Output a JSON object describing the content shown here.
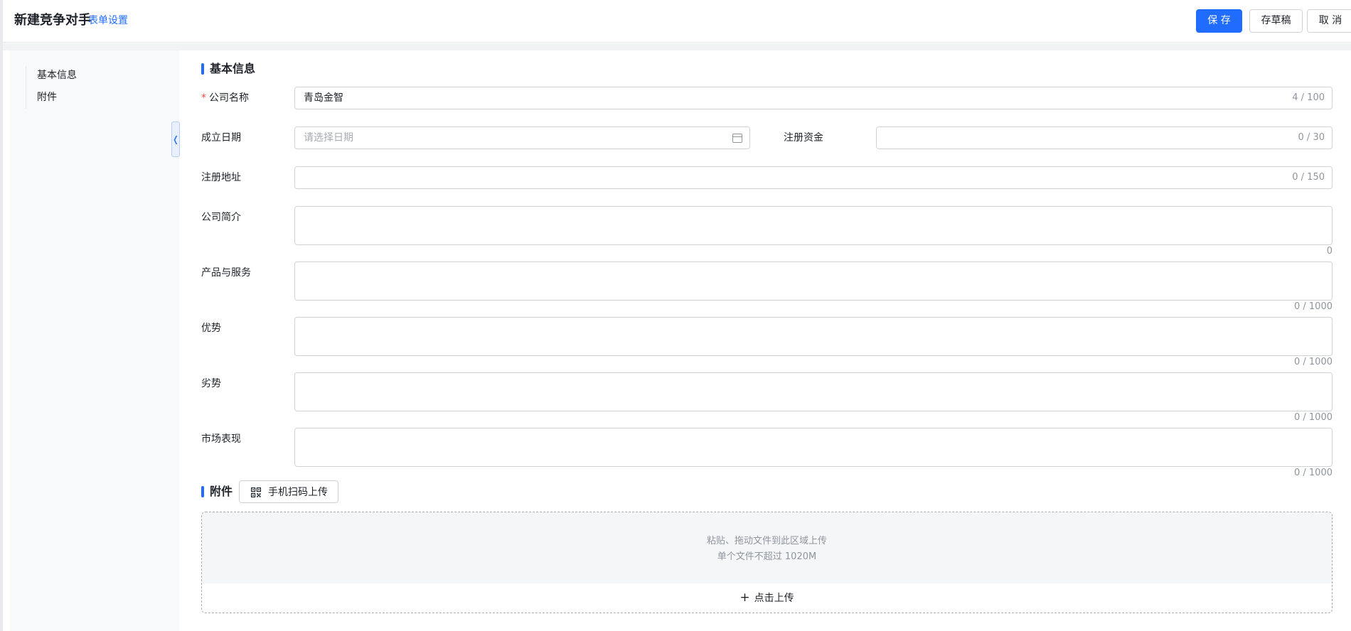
{
  "header": {
    "title": "新建竞争对手",
    "form_settings": "表单设置",
    "save": "保 存",
    "draft": "存草稿",
    "cancel": "取 消"
  },
  "sidebar": {
    "items": [
      {
        "label": "基本信息"
      },
      {
        "label": "附件"
      }
    ],
    "collapse_icon": "chevron-left-icon"
  },
  "basic": {
    "section_title": "基本信息",
    "required_mark": "*",
    "company_name": {
      "label": "公司名称",
      "value": "青岛金智",
      "counter": "4 / 100"
    },
    "founded_date": {
      "label": "成立日期",
      "placeholder": "请选择日期",
      "icon": "calendar-icon"
    },
    "registered_capital": {
      "label": "注册资金",
      "value": "",
      "counter": "0 / 30"
    },
    "registered_address": {
      "label": "注册地址",
      "value": "",
      "counter": "0 / 150"
    },
    "company_intro": {
      "label": "公司简介",
      "value": "",
      "counter": "0"
    },
    "products_services": {
      "label": "产品与服务",
      "value": "",
      "counter": "0 / 1000"
    },
    "strengths": {
      "label": "优势",
      "value": "",
      "counter": "0 / 1000"
    },
    "weaknesses": {
      "label": "劣势",
      "value": "",
      "counter": "0 / 1000"
    },
    "market_performance": {
      "label": "市场表现",
      "value": "",
      "counter": "0 / 1000"
    }
  },
  "attachments": {
    "section_title": "附件",
    "qr_upload": "手机扫码上传",
    "qr_icon": "qr-code-icon",
    "drop_hint": "粘贴、拖动文件到此区域上传",
    "size_limit": "单个文件不超过 1020M",
    "click_upload": "点击上传",
    "plus_icon": "plus-icon"
  },
  "colors": {
    "accent": "#1f6cff",
    "required": "#f54a45",
    "border": "#d0d3d6",
    "muted_text": "#8f959e"
  }
}
